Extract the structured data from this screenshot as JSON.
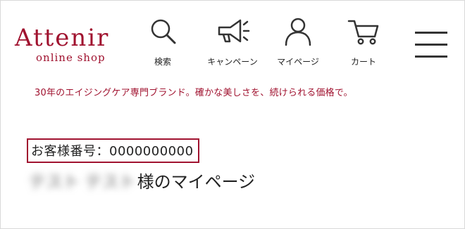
{
  "header": {
    "logo_main": "Attenir",
    "logo_sub": "online shop",
    "nav": [
      {
        "label": "検索",
        "icon": "search-icon"
      },
      {
        "label": "キャンペーン",
        "icon": "megaphone-icon"
      },
      {
        "label": "マイページ",
        "icon": "user-icon"
      },
      {
        "label": "カート",
        "icon": "cart-icon"
      }
    ],
    "menu_icon": "hamburger-menu-icon"
  },
  "tagline": "30年のエイジングケア専門ブランド。確かな美しさを、続けられる価格で。",
  "customer": {
    "number_label": "お客様番号：0000000000",
    "name": "テスト テスト",
    "title_suffix": "様のマイページ"
  },
  "colors": {
    "brand": "#a0122f",
    "text": "#222222",
    "border": "#d9d9d9"
  }
}
